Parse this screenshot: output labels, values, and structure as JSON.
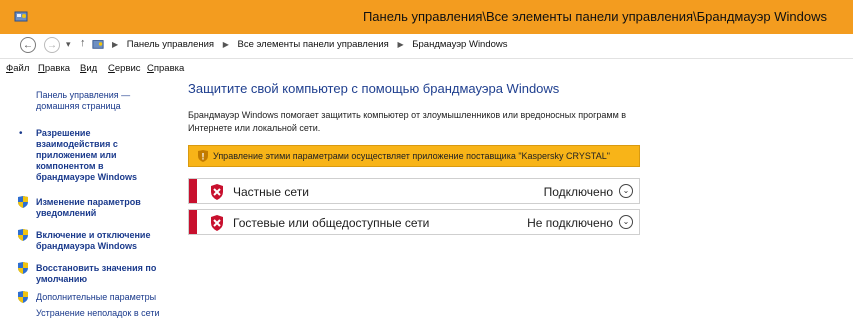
{
  "window": {
    "title": "Панель управления\\Все элементы панели управления\\Брандмауэр Windows"
  },
  "addressbar": {
    "breadcrumbs": [
      "Панель управления",
      "Все элементы панели управления",
      "Брандмауэр Windows"
    ]
  },
  "menubar": {
    "items": [
      "Файл",
      "Правка",
      "Вид",
      "Сервис",
      "Справка"
    ],
    "mnemonics": [
      "Ф",
      "П",
      "В",
      "С",
      "С"
    ]
  },
  "sidebar": {
    "home_link": "Панель управления — домашняя страница",
    "items": [
      "Разрешение взаимодействия с приложением или компонентом в брандмауэре Windows",
      "Изменение параметров уведомлений",
      "Включение и отключение брандмауэра Windows",
      "Восстановить значения по умолчанию",
      "Дополнительные параметры",
      "Устранение неполадок в сети"
    ]
  },
  "main": {
    "title": "Защитите свой компьютер с помощью брандмауэра Windows",
    "description": "Брандмауэр Windows помогает защитить компьютер от злоумышленников или вредоносных программ в Интернете или локальной сети.",
    "warning": "Управление этими параметрами осуществляет приложение поставщика \"Kaspersky CRYSTAL\"",
    "networks": [
      {
        "name": "Частные сети",
        "status": "Подключено"
      },
      {
        "name": "Гостевые или общедоступные сети",
        "status": "Не подключено"
      }
    ]
  },
  "colors": {
    "titlebar": "#f39c1f",
    "warning_bg": "#f8b418",
    "network_marker": "#c8102e",
    "link": "#1a3a8c",
    "heading": "#1f3f8f"
  },
  "icons": {
    "app": "control-panel-icon",
    "shield": "uac-shield-icon",
    "warning": "shield-warning-icon",
    "network_status": "red-x-shield-icon",
    "expand": "chevron-down-icon"
  }
}
